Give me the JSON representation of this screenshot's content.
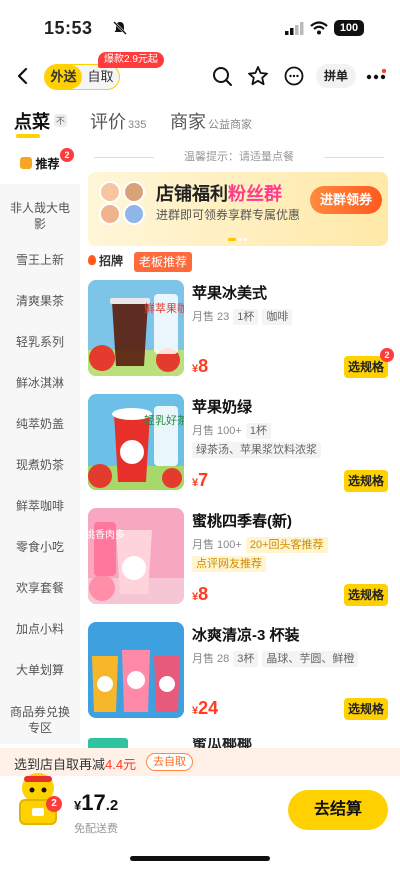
{
  "status_bar": {
    "time": "15:53",
    "battery": "100"
  },
  "nav": {
    "mode_delivery": "外送",
    "mode_pickup": "自取",
    "promo": "爆款2.9元起",
    "pindan": "拼单"
  },
  "tabs": {
    "order": "点菜",
    "order_badge": "不",
    "reviews": "评价",
    "reviews_count": "335",
    "merchant": "商家",
    "merchant_sub": "公益商家"
  },
  "sidebar": {
    "items": [
      {
        "label": "推荐",
        "badge": "2"
      },
      {
        "label": "非人哉大电影"
      },
      {
        "label": "雪王上新"
      },
      {
        "label": "清爽果茶"
      },
      {
        "label": "轻乳系列"
      },
      {
        "label": "鲜冰淇淋"
      },
      {
        "label": "纯萃奶盖"
      },
      {
        "label": "现煮奶茶"
      },
      {
        "label": "鲜萃咖啡"
      },
      {
        "label": "零食小吃"
      },
      {
        "label": "欢享套餐"
      },
      {
        "label": "加点小料"
      },
      {
        "label": "大单划算"
      },
      {
        "label": "商品券兑换专区"
      }
    ]
  },
  "tip": "温馨提示：请适量点餐",
  "banner": {
    "title_main": "店铺福利",
    "title_highlight": "粉丝群",
    "subtitle": "进群即可领券享群专属优惠",
    "button": "进群领券"
  },
  "section_tags": {
    "zhaopai": "招牌",
    "boss": "老板推荐"
  },
  "products": [
    {
      "name": "苹果冰美式",
      "sales": "月售 23",
      "chips": [
        "1杯",
        "咖啡"
      ],
      "tags": [],
      "price": "8",
      "button": "选规格",
      "badge": "2",
      "img_text": "鲜萃果咖"
    },
    {
      "name": "苹果奶绿",
      "sales": "月售 100+",
      "chips": [
        "1杯"
      ],
      "tags": [
        "绿茶汤、苹果浆饮料浓浆"
      ],
      "price": "7",
      "button": "选规格",
      "badge": "",
      "img_text": "轻乳好茶"
    },
    {
      "name": "蜜桃四季春(新)",
      "sales": "月售 100+",
      "chips": [],
      "tags": [
        "20+回头客推荐",
        "点评网友推荐"
      ],
      "price": "8",
      "button": "选规格",
      "badge": "",
      "img_text": "桃香肉多"
    },
    {
      "name": "冰爽清凉-3 杯装",
      "sales": "月售 28",
      "chips": [
        "3杯",
        "晶球、芋圆、鲜橙"
      ],
      "tags": [],
      "price": "24",
      "button": "选规格",
      "badge": "",
      "img_text": ""
    }
  ],
  "partial_product": {
    "name": "蜜瓜椰椰",
    "tag": "新品"
  },
  "pickup_bar": {
    "text_pre": "选到店自取再减",
    "amount": "4.4元",
    "button": "去自取"
  },
  "cart": {
    "badge": "2",
    "currency": "¥",
    "total_int": "17",
    "total_dec": ".2",
    "fee": "免配送费",
    "checkout": "去结算"
  },
  "colors": {
    "brand_yellow": "#ffd100",
    "price_red": "#ff3b1f",
    "accent_orange": "#ff6a3d"
  }
}
